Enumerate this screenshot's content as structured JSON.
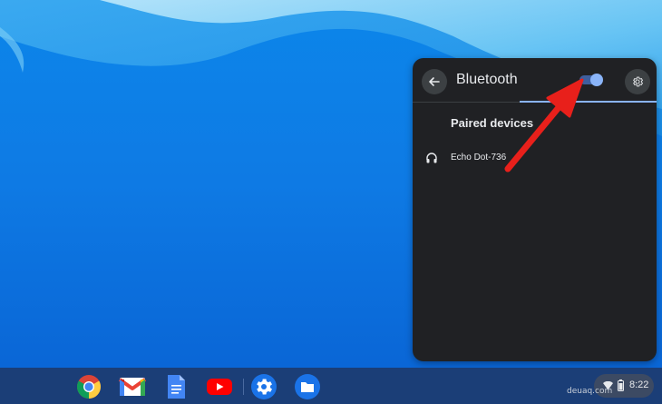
{
  "panel": {
    "title": "Bluetooth",
    "toggle_state": "on",
    "section_heading": "Paired devices",
    "devices": [
      {
        "name": "Echo Dot-736",
        "icon": "headphones-icon"
      }
    ]
  },
  "shelf": {
    "apps": [
      {
        "name": "chrome-icon"
      },
      {
        "name": "gmail-icon"
      },
      {
        "name": "docs-icon"
      },
      {
        "name": "youtube-icon"
      },
      {
        "name": "settings-icon"
      },
      {
        "name": "files-icon"
      }
    ],
    "status": {
      "time": "8:22",
      "icons": [
        "wifi-icon",
        "battery-icon"
      ]
    }
  },
  "watermark": "deuaq.com",
  "colors": {
    "panel_bg": "#202124",
    "accent": "#8ab4f8",
    "shelf_bg": "#1b3e77",
    "annotation_arrow": "#e8201b"
  }
}
